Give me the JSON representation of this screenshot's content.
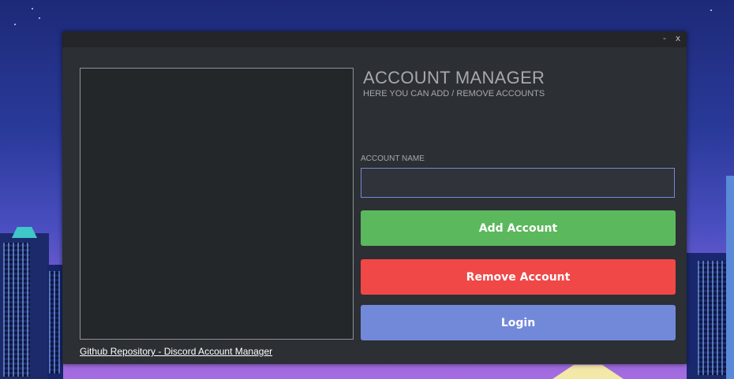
{
  "titlebar": {
    "minimize_label": "-",
    "close_label": "x"
  },
  "header": {
    "title": "ACCOUNT MANAGER",
    "subtitle": "HERE YOU CAN ADD / REMOVE ACCOUNTS"
  },
  "form": {
    "account_name_label": "ACCOUNT NAME",
    "account_name_value": ""
  },
  "buttons": {
    "add_label": "Add Account",
    "remove_label": "Remove Account",
    "login_label": "Login"
  },
  "footer": {
    "link_text": "Github Repository - Discord Account Manager"
  },
  "colors": {
    "window_bg": "#2c2f33",
    "add": "#5cb85c",
    "remove": "#f04747",
    "login": "#7289da"
  }
}
